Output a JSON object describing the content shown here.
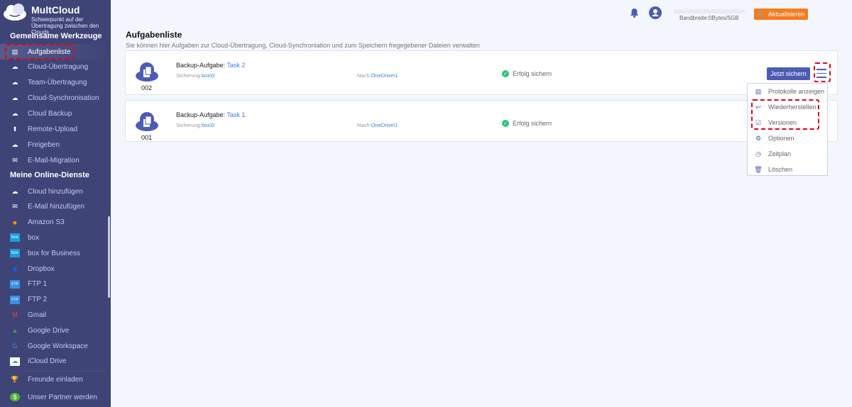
{
  "brand": {
    "name": "MultCloud",
    "tagline": "Schwerpunkt auf der Übertragung zwischen den Clouds"
  },
  "sidebar": {
    "section1": "Gemeinsame Werkzeuge",
    "tools": [
      {
        "label": "Aufgabenliste",
        "icon": "clipboard-icon"
      },
      {
        "label": "Cloud-Übertragung",
        "icon": "cloud-transfer-icon"
      },
      {
        "label": "Team-Übertragung",
        "icon": "team-transfer-icon"
      },
      {
        "label": "Cloud-Synchronisation",
        "icon": "cloud-sync-icon"
      },
      {
        "label": "Cloud Backup",
        "icon": "cloud-backup-icon"
      },
      {
        "label": "Remote-Upload",
        "icon": "upload-icon"
      },
      {
        "label": "Freigeben",
        "icon": "share-icon"
      },
      {
        "label": "E-Mail-Migration",
        "icon": "email-migration-icon"
      }
    ],
    "section2": "Meine Online-Dienste",
    "services": [
      {
        "label": "Cloud hinzufügen",
        "icon": "add-cloud-icon",
        "color": "#ffffff"
      },
      {
        "label": "E-Mail hinzufügen",
        "icon": "add-email-icon",
        "color": "#ffffff"
      },
      {
        "label": "Amazon S3",
        "icon": "amazon-s3-icon",
        "color": "#f29111"
      },
      {
        "label": "box",
        "icon": "box-icon",
        "color": "#1a9ee0"
      },
      {
        "label": "box for Business",
        "icon": "box-icon",
        "color": "#1a9ee0"
      },
      {
        "label": "Dropbox",
        "icon": "dropbox-icon",
        "color": "#0d61ff"
      },
      {
        "label": "FTP 1",
        "icon": "ftp-icon",
        "color": "#3b8fe6"
      },
      {
        "label": "FTP 2",
        "icon": "ftp-icon",
        "color": "#3b8fe6"
      },
      {
        "label": "Gmail",
        "icon": "gmail-icon",
        "color": "#ea4335"
      },
      {
        "label": "Google Drive",
        "icon": "google-drive-icon",
        "color": "#34a853"
      },
      {
        "label": "Google Workspace",
        "icon": "google-icon",
        "color": "#4285f4"
      },
      {
        "label": "iCloud Drive",
        "icon": "icloud-icon",
        "color": "#ffffff"
      }
    ],
    "footer": [
      {
        "label": "Freunde einladen",
        "icon": "trophy-icon",
        "color": "#5bbf2a"
      },
      {
        "label": "Unser Partner werden",
        "icon": "dollar-icon",
        "color": "#4fb82c"
      }
    ]
  },
  "header": {
    "bandwidth": "Bandbreite:0Bytes/5GB",
    "upgrade": "Aktualisieren"
  },
  "main": {
    "title": "Aufgabenliste",
    "subtitle": "Sie können hier Aufgaben zur Cloud-Übertragung, Cloud-Synchroniation und zum Speichern fregegebener Dateien verwalten",
    "tasks": [
      {
        "num": "002",
        "type": "Backup-Aufgabe: ",
        "name": "Task 2",
        "src_label": "Sicherung:",
        "src": "box\\0",
        "dst_label": "Nach:",
        "dst": "OneDrive\\1",
        "status": "Erfolg sichern"
      },
      {
        "num": "001",
        "type": "Backup-Aufgabe: ",
        "name": "Task 1",
        "src_label": "Sicherung:",
        "src": "box\\0",
        "dst_label": "Nach:",
        "dst": "OneDrive\\1",
        "status": "Erfolg sichern"
      }
    ],
    "backup_now": "Jetzt sichern",
    "menu": [
      "Protokolle anzeigen",
      "Wiederherstellen",
      "Versionen",
      "Optionen",
      "Zeitplan",
      "Löschen"
    ]
  }
}
